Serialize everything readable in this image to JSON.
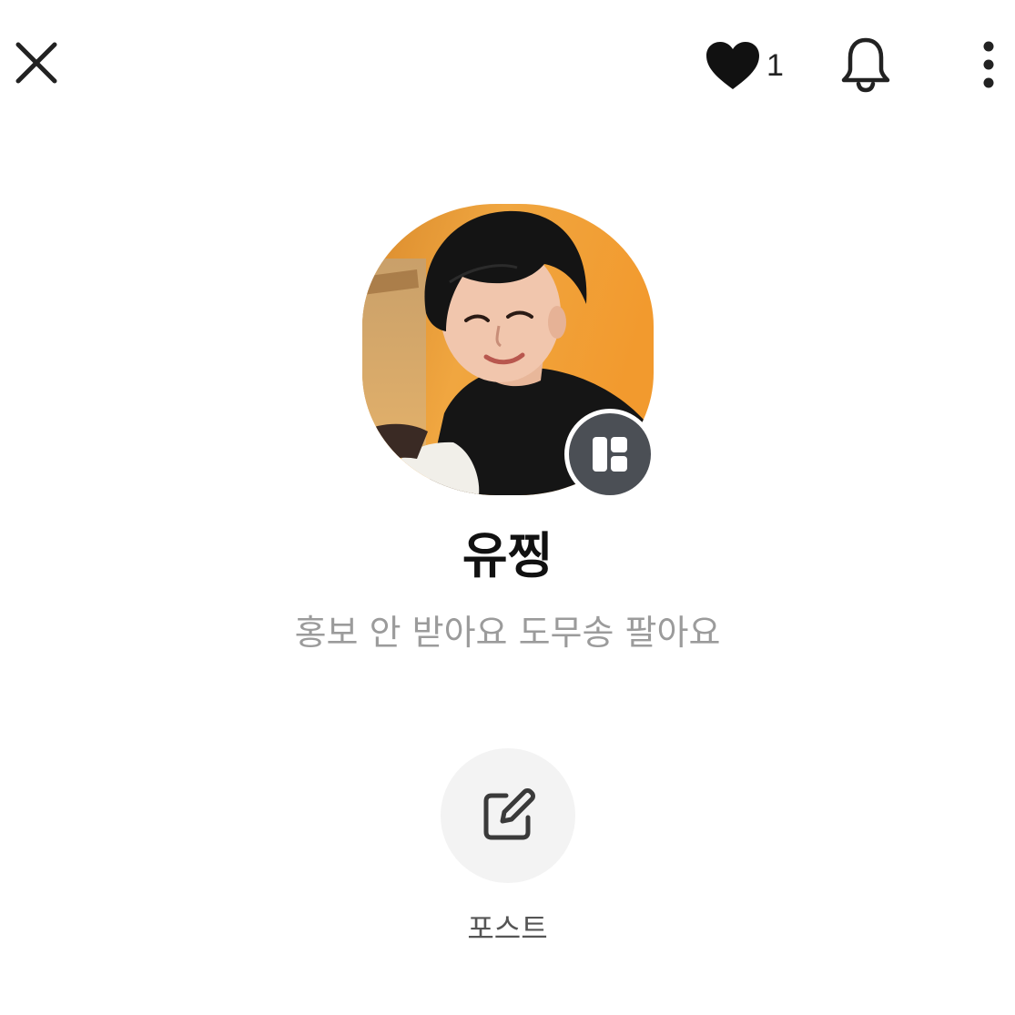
{
  "header": {
    "close_icon": "close-icon",
    "like_icon": "heart-icon",
    "like_count": "1",
    "notification_icon": "bell-icon",
    "more_icon": "more-vertical-icon"
  },
  "profile": {
    "avatar": "profile-photo",
    "badge_icon": "profile-type-icon",
    "name": "유찡",
    "bio": "홍보 안 받아요 도무송 팔아요"
  },
  "actions": {
    "post_icon": "edit-icon",
    "post_label": "포스트"
  },
  "colors": {
    "background": "#ffffff",
    "badge": "#4b4f55",
    "bio_text": "#9b9b9b",
    "action_circle": "#f3f3f3"
  }
}
